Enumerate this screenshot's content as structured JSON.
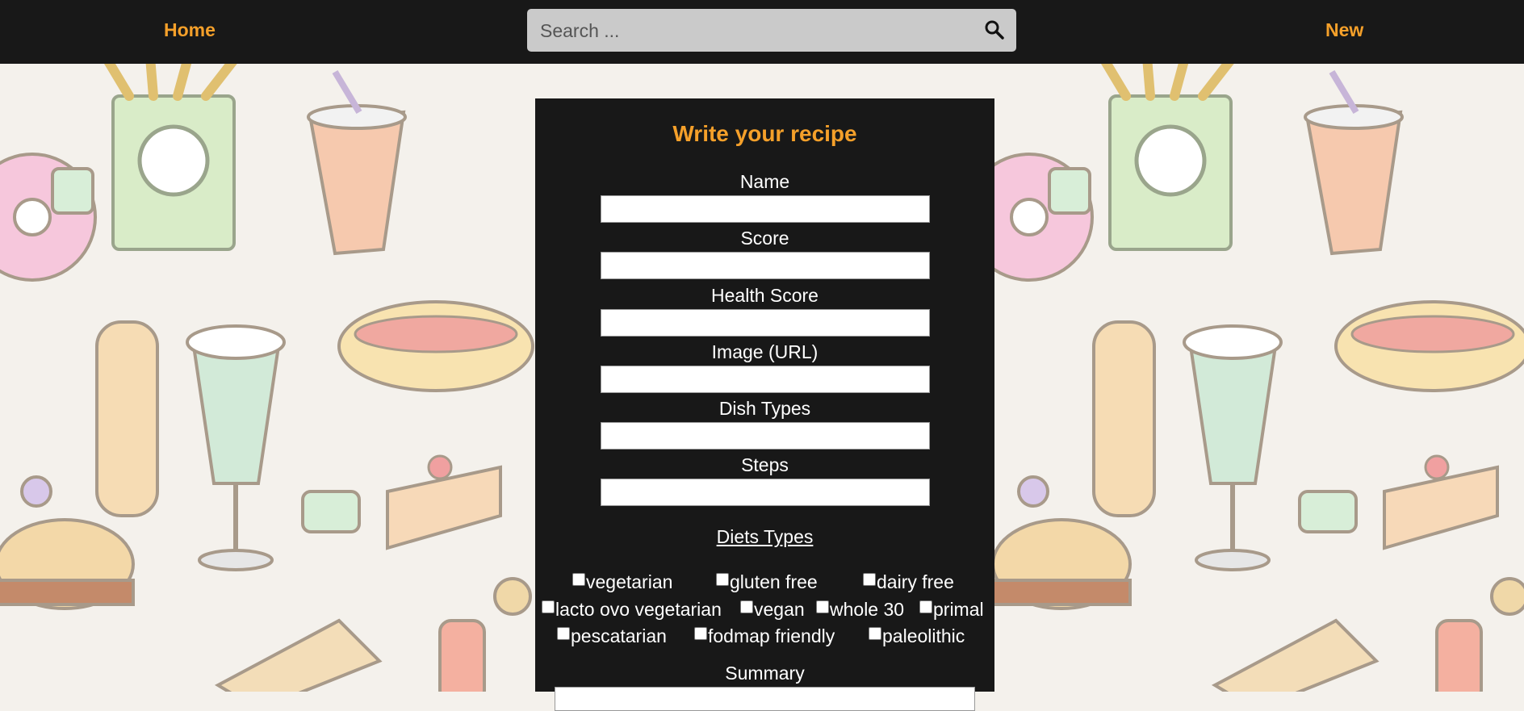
{
  "nav": {
    "home_label": "Home",
    "new_label": "New"
  },
  "search": {
    "placeholder": "Search ...",
    "icon": "search-icon"
  },
  "form": {
    "title": "Write your recipe",
    "fields": [
      {
        "label": "Name",
        "value": ""
      },
      {
        "label": "Score",
        "value": ""
      },
      {
        "label": "Health Score",
        "value": ""
      },
      {
        "label": "Image (URL)",
        "value": ""
      },
      {
        "label": "Dish Types",
        "value": ""
      },
      {
        "label": "Steps",
        "value": ""
      }
    ],
    "diets_title": "Diets Types",
    "diets": [
      {
        "label": "vegetarian",
        "checked": false
      },
      {
        "label": "gluten free",
        "checked": false
      },
      {
        "label": "dairy free",
        "checked": false
      },
      {
        "label": "lacto ovo vegetarian",
        "checked": false
      },
      {
        "label": "vegan",
        "checked": false
      },
      {
        "label": "whole 30",
        "checked": false
      },
      {
        "label": "primal",
        "checked": false
      },
      {
        "label": "pescatarian",
        "checked": false
      },
      {
        "label": "fodmap friendly",
        "checked": false
      },
      {
        "label": "paleolithic",
        "checked": false
      }
    ],
    "summary_label": "Summary"
  },
  "colors": {
    "accent": "#f5a02a",
    "bar": "#181818",
    "panel": "#181818"
  }
}
